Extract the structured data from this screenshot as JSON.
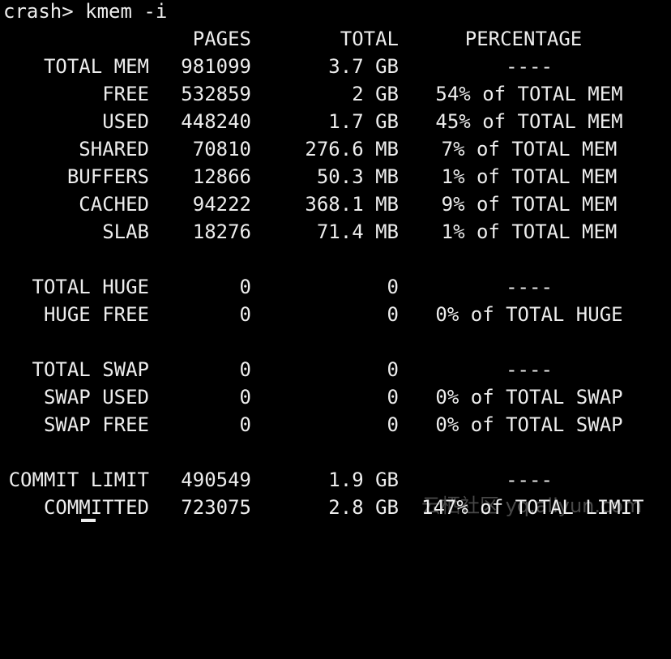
{
  "terminal": {
    "prompt": "crash> kmem -i",
    "headers": {
      "pages": "PAGES",
      "total": "TOTAL",
      "percentage": "PERCENTAGE"
    },
    "rows": [
      {
        "label": "TOTAL MEM",
        "pages": "981099",
        "total": "3.7 GB",
        "pct": "----"
      },
      {
        "label": "FREE",
        "pages": "532859",
        "total": "2 GB",
        "pct": "54% of TOTAL MEM"
      },
      {
        "label": "USED",
        "pages": "448240",
        "total": "1.7 GB",
        "pct": "45% of TOTAL MEM"
      },
      {
        "label": "SHARED",
        "pages": "70810",
        "total": "276.6 MB",
        "pct": "7% of TOTAL MEM"
      },
      {
        "label": "BUFFERS",
        "pages": "12866",
        "total": "50.3 MB",
        "pct": "1% of TOTAL MEM"
      },
      {
        "label": "CACHED",
        "pages": "94222",
        "total": "368.1 MB",
        "pct": "9% of TOTAL MEM"
      },
      {
        "label": "SLAB",
        "pages": "18276",
        "total": "71.4 MB",
        "pct": "1% of TOTAL MEM"
      },
      {
        "label": "TOTAL HUGE",
        "pages": "0",
        "total": "0",
        "pct": "----"
      },
      {
        "label": "HUGE FREE",
        "pages": "0",
        "total": "0",
        "pct": "0% of TOTAL HUGE"
      },
      {
        "label": "TOTAL SWAP",
        "pages": "0",
        "total": "0",
        "pct": "----"
      },
      {
        "label": "SWAP USED",
        "pages": "0",
        "total": "0",
        "pct": "0% of TOTAL SWAP"
      },
      {
        "label": "SWAP FREE",
        "pages": "0",
        "total": "0",
        "pct": "0% of TOTAL SWAP"
      },
      {
        "label": "COMMIT LIMIT",
        "pages": "490549",
        "total": "1.9 GB",
        "pct": "----"
      },
      {
        "label": "COMMITTED",
        "pages": "723075",
        "total": "2.8 GB",
        "pct": "147% of TOTAL LIMIT"
      }
    ],
    "watermark": "云栖社区 yq.aliyun.com"
  }
}
